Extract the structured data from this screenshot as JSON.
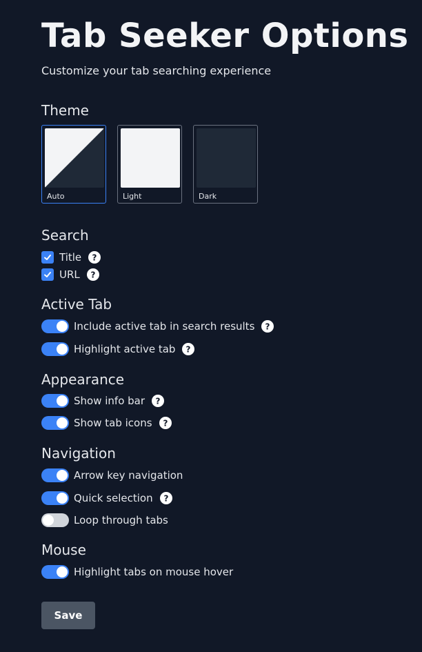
{
  "header": {
    "title": "Tab Seeker Options",
    "subtitle": "Customize your tab searching experience"
  },
  "theme": {
    "heading": "Theme",
    "selected": "Auto",
    "options": [
      {
        "label": "Auto",
        "colors": [
          "#f3f4f6",
          "#1f2937"
        ]
      },
      {
        "label": "Light",
        "colors": [
          "#f3f4f6"
        ]
      },
      {
        "label": "Dark",
        "colors": [
          "#1f2937"
        ]
      }
    ]
  },
  "search": {
    "heading": "Search",
    "items": [
      {
        "label": "Title",
        "checked": true
      },
      {
        "label": "URL",
        "checked": true
      }
    ]
  },
  "active_tab": {
    "heading": "Active Tab",
    "items": [
      {
        "label": "Include active tab in search results",
        "on": true
      },
      {
        "label": "Highlight active tab",
        "on": true
      }
    ]
  },
  "appearance": {
    "heading": "Appearance",
    "items": [
      {
        "label": "Show info bar",
        "on": true
      },
      {
        "label": "Show tab icons",
        "on": true
      }
    ]
  },
  "navigation": {
    "heading": "Navigation",
    "items": [
      {
        "label": "Arrow key navigation",
        "on": true
      },
      {
        "label": "Quick selection",
        "on": true
      },
      {
        "label": "Loop through tabs",
        "on": false
      }
    ]
  },
  "mouse": {
    "heading": "Mouse",
    "items": [
      {
        "label": "Highlight tabs on mouse hover",
        "on": true
      }
    ]
  },
  "save_label": "Save",
  "colors": {
    "background": "#111827",
    "accent": "#3b82f6",
    "toggle_off": "#d1d5db",
    "button": "#4b5563"
  }
}
